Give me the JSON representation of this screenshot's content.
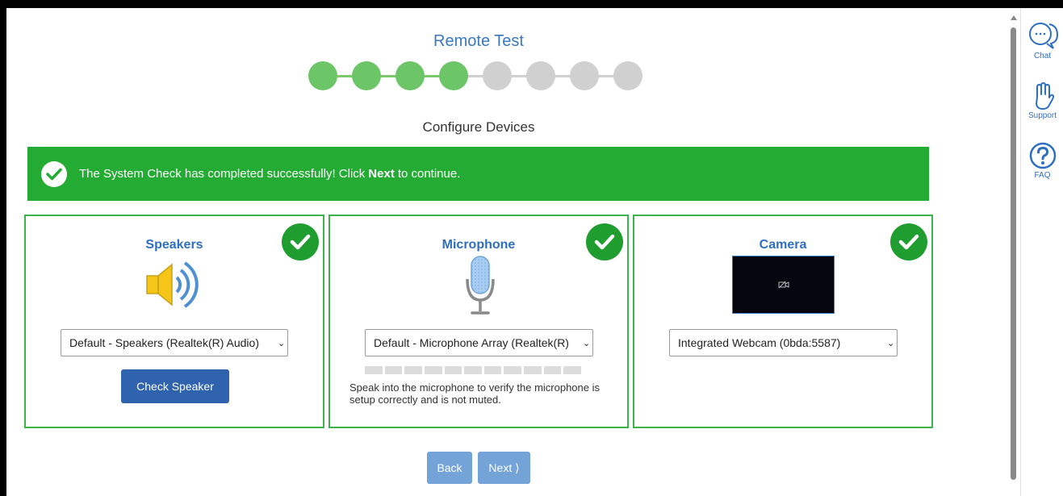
{
  "header": {
    "title": "Remote Test",
    "subtitle": "Configure Devices"
  },
  "stepper": {
    "total": 8,
    "completed": 4
  },
  "banner": {
    "text_before": "The System Check has completed successfully! Click",
    "bold": "Next",
    "text_after": "to continue."
  },
  "speakers": {
    "heading": "Speakers",
    "selected_device": "Default - Speakers (Realtek(R) Audio)",
    "button_label": "Check Speaker"
  },
  "microphone": {
    "heading": "Microphone",
    "selected_device": "Default - Microphone Array (Realtek(R)",
    "meter_segments": 11,
    "meter_level": 0,
    "hint": "Speak into the microphone to verify the microphone is setup correctly and is not muted."
  },
  "camera": {
    "heading": "Camera",
    "selected_device": "Integrated Webcam (0bda:5587)"
  },
  "nav": {
    "back_label": "Back",
    "next_label": "Next ⟩"
  },
  "rail": {
    "chat_label": "Chat",
    "support_label": "Support",
    "faq_label": "FAQ"
  },
  "colors": {
    "accent_blue": "#3a78c2",
    "success_green": "#24ab34",
    "step_done": "#6cc566",
    "step_pending": "#d0d0d0"
  }
}
